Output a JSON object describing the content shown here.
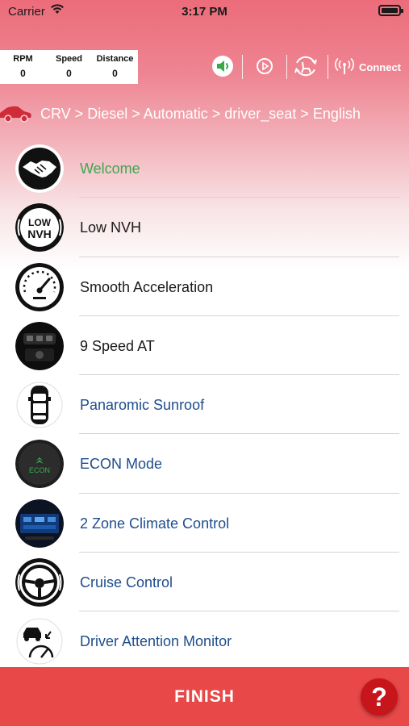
{
  "status_bar": {
    "carrier": "Carrier",
    "time": "3:17 PM"
  },
  "stats": {
    "rpm_label": "RPM",
    "rpm_value": "0",
    "speed_label": "Speed",
    "speed_value": "0",
    "distance_label": "Distance",
    "distance_value": "0"
  },
  "toolbar": {
    "connect_label": "Connect",
    "icons": [
      "speaker-icon",
      "play-icon",
      "rotate-seat-icon",
      "wireless-signal-icon"
    ]
  },
  "breadcrumb": {
    "text": "CRV > Diesel > Automatic > driver_seat > English"
  },
  "features": [
    {
      "label": "Welcome",
      "icon": "handshake-icon",
      "color": "#3ba84e"
    },
    {
      "label": "Low NVH",
      "icon": "low-nvh-icon",
      "color": "#1a1a1a"
    },
    {
      "label": "Smooth Acceleration",
      "icon": "speedometer-icon",
      "color": "#1a1a1a"
    },
    {
      "label": "9 Speed AT",
      "icon": "gear-shifter-icon",
      "color": "#1a1a1a"
    },
    {
      "label": "Panaromic Sunroof",
      "icon": "car-top-view-icon",
      "color": "#1e4d8c"
    },
    {
      "label": "ECON Mode",
      "icon": "econ-icon",
      "econ_text": "ECON",
      "color": "#1e4d8c"
    },
    {
      "label": "2 Zone Climate Control",
      "icon": "climate-display-icon",
      "color": "#1e4d8c"
    },
    {
      "label": "Cruise Control",
      "icon": "steering-wheel-icon",
      "color": "#1e4d8c"
    },
    {
      "label": "Driver Attention Monitor",
      "icon": "driver-attention-icon",
      "color": "#1e4d8c"
    }
  ],
  "footer": {
    "finish_label": "FINISH",
    "help_label": "?"
  },
  "colors": {
    "accent_red": "#e84848",
    "help_red": "#c7151c",
    "welcome_green": "#3ba84e",
    "link_blue": "#1e4d8c"
  }
}
